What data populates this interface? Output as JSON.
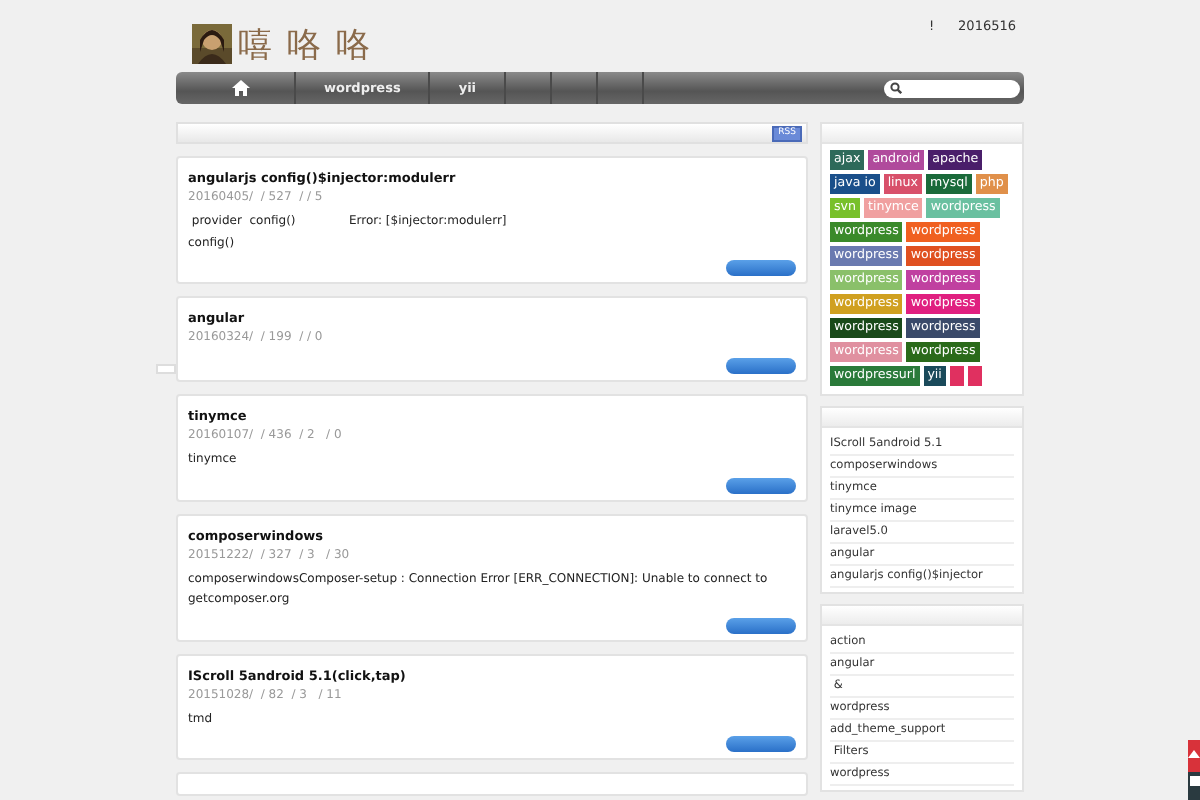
{
  "header": {
    "title": "嘻 咯 咯",
    "notice": "!",
    "date": "2016516"
  },
  "nav": {
    "items": [
      {
        "kind": "home"
      },
      {
        "kind": "text",
        "label": "wordpress"
      },
      {
        "kind": "text",
        "label": "yii"
      },
      {
        "kind": "empty"
      },
      {
        "kind": "empty"
      },
      {
        "kind": "empty"
      }
    ]
  },
  "rss": "RSS",
  "posts": [
    {
      "title": "angularjs config()$injector:modulerr",
      "meta": "20160405/  / 527  / / 5",
      "excerpt": [
        " provider  config()              Error: [$injector:modulerr]",
        "config()"
      ]
    },
    {
      "title": "angular",
      "meta": "20160324/  / 199  / / 0"
    },
    {
      "title": "tinymce",
      "meta": "20160107/  / 436  / 2   / 0",
      "excerpt": [
        "tinymce"
      ]
    },
    {
      "title": "composerwindows",
      "meta": "20151222/  / 327  / 3   / 30",
      "excerpt": [
        "composerwindowsComposer-setup : Connection Error [ERR_CONNECTION]: Unable to connect to",
        "getcomposer.org"
      ]
    },
    {
      "title": "IScroll 5android 5.1(click,tap)",
      "meta": "20151028/  / 82  / 3   / 11",
      "excerpt": [
        "tmd"
      ]
    }
  ],
  "tags": [
    {
      "label": "ajax",
      "color": "#2e6a5a"
    },
    {
      "label": "android",
      "color": "#b04a9c"
    },
    {
      "label": "apache",
      "color": "#4a1e6a"
    },
    {
      "label": "java io",
      "color": "#1a4f8a"
    },
    {
      "label": "linux",
      "color": "#d8506a"
    },
    {
      "label": "mysql",
      "color": "#1a6a3a"
    },
    {
      "label": "php",
      "color": "#e0904a"
    },
    {
      "label": "svn",
      "color": "#78c02a"
    },
    {
      "label": "tinymce",
      "color": "#f0a0a0"
    },
    {
      "label": "wordpress",
      "color": "#6ac0a0"
    },
    {
      "label": "wordpress",
      "color": "#3a8a2a"
    },
    {
      "label": "wordpress",
      "color": "#f06020"
    },
    {
      "label": "wordpress",
      "color": "#6a7ab0"
    },
    {
      "label": "wordpress",
      "color": "#e05020"
    },
    {
      "label": "wordpress",
      "color": "#8ac06a"
    },
    {
      "label": "wordpress",
      "color": "#c040a0"
    },
    {
      "label": "wordpress",
      "color": "#d0a020"
    },
    {
      "label": "wordpress",
      "color": "#e02080"
    },
    {
      "label": "wordpress",
      "color": "#1a4a1a"
    },
    {
      "label": "wordpress",
      "color": "#3a4a6a"
    },
    {
      "label": "wordpress",
      "color": "#e090a0"
    },
    {
      "label": "wordpress",
      "color": "#2a6a1a"
    },
    {
      "label": "wordpressurl",
      "color": "#2a7a3a"
    },
    {
      "label": "yii",
      "color": "#1a4a5a"
    }
  ],
  "blank_tags": [
    {
      "color": "#e03060"
    },
    {
      "color": "#e03060"
    }
  ],
  "recent_posts": [
    "IScroll 5android 5.1",
    "composerwindows",
    "tinymce",
    "tinymce image",
    "laravel5.0",
    "angular",
    "angularjs config()$injector"
  ],
  "recent_tags": [
    "action",
    "angular",
    " &",
    "wordpress",
    "add_theme_support",
    " Filters",
    "wordpress"
  ]
}
